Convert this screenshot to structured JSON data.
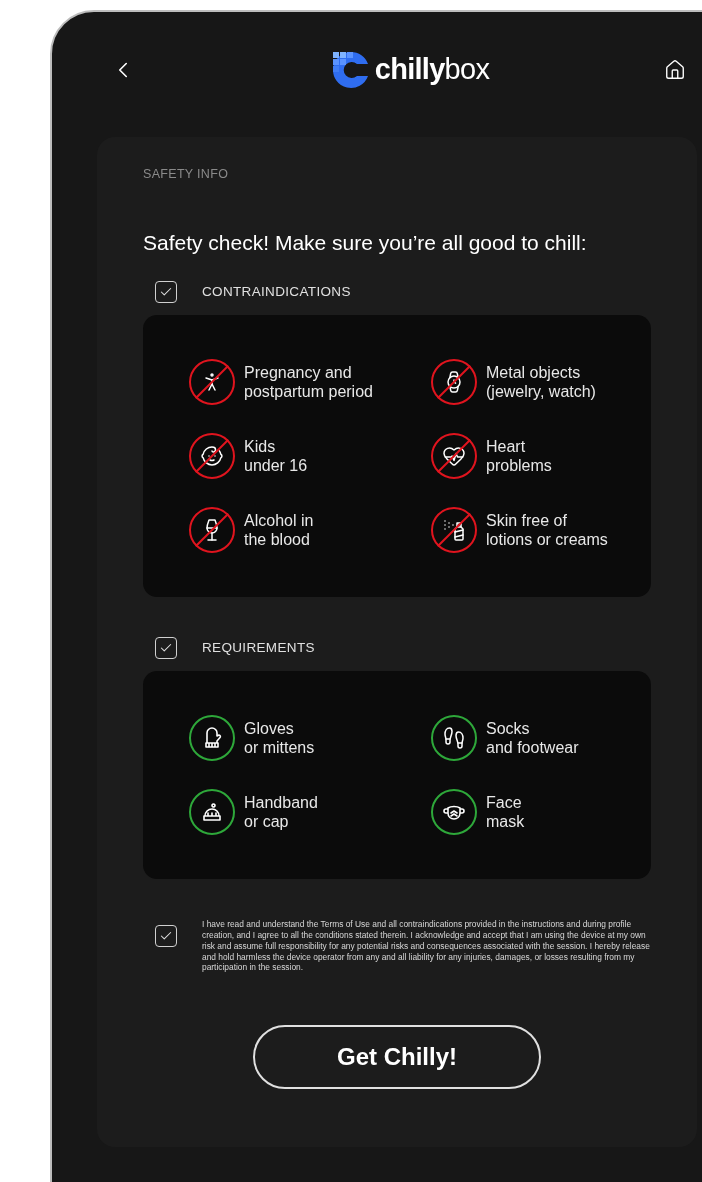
{
  "header": {
    "logo": {
      "bold": "chilly",
      "light": "box"
    }
  },
  "card": {
    "label": "SAFETY INFO",
    "title": "Safety check! Make sure you’re all good to chill:",
    "sections": [
      {
        "kind": "prohibited",
        "label": "CONTRAINDICATIONS",
        "checked": true,
        "items": [
          {
            "text": "Pregnancy and\npostpartum period"
          },
          {
            "text": "Metal objects\n(jewelry, watch)"
          },
          {
            "text": "Kids\nunder 16"
          },
          {
            "text": "Heart\nproblems"
          },
          {
            "text": "Alcohol in\nthe blood"
          },
          {
            "text": "Skin free of\nlotions or creams"
          }
        ]
      },
      {
        "kind": "required",
        "label": "REQUIREMENTS",
        "checked": true,
        "items": [
          {
            "text": "Gloves\nor mittens"
          },
          {
            "text": "Socks\nand footwear"
          },
          {
            "text": "Handband\nor cap"
          },
          {
            "text": "Face\nmask"
          }
        ]
      }
    ],
    "consent": {
      "checked": true,
      "text": "I have read and understand the Terms of Use and all contraindications provided in the instructions and during profile creation, and I agree to all the conditions stated therein. I acknowledge and accept that I am using the device at my own risk and assume full responsibility for any potential risks and consequences associated with the session. I hereby release and hold harmless the device operator from any and all liability for any injuries, damages, or losses resulting from my participation in the session."
    },
    "button": "Get Chilly!"
  }
}
